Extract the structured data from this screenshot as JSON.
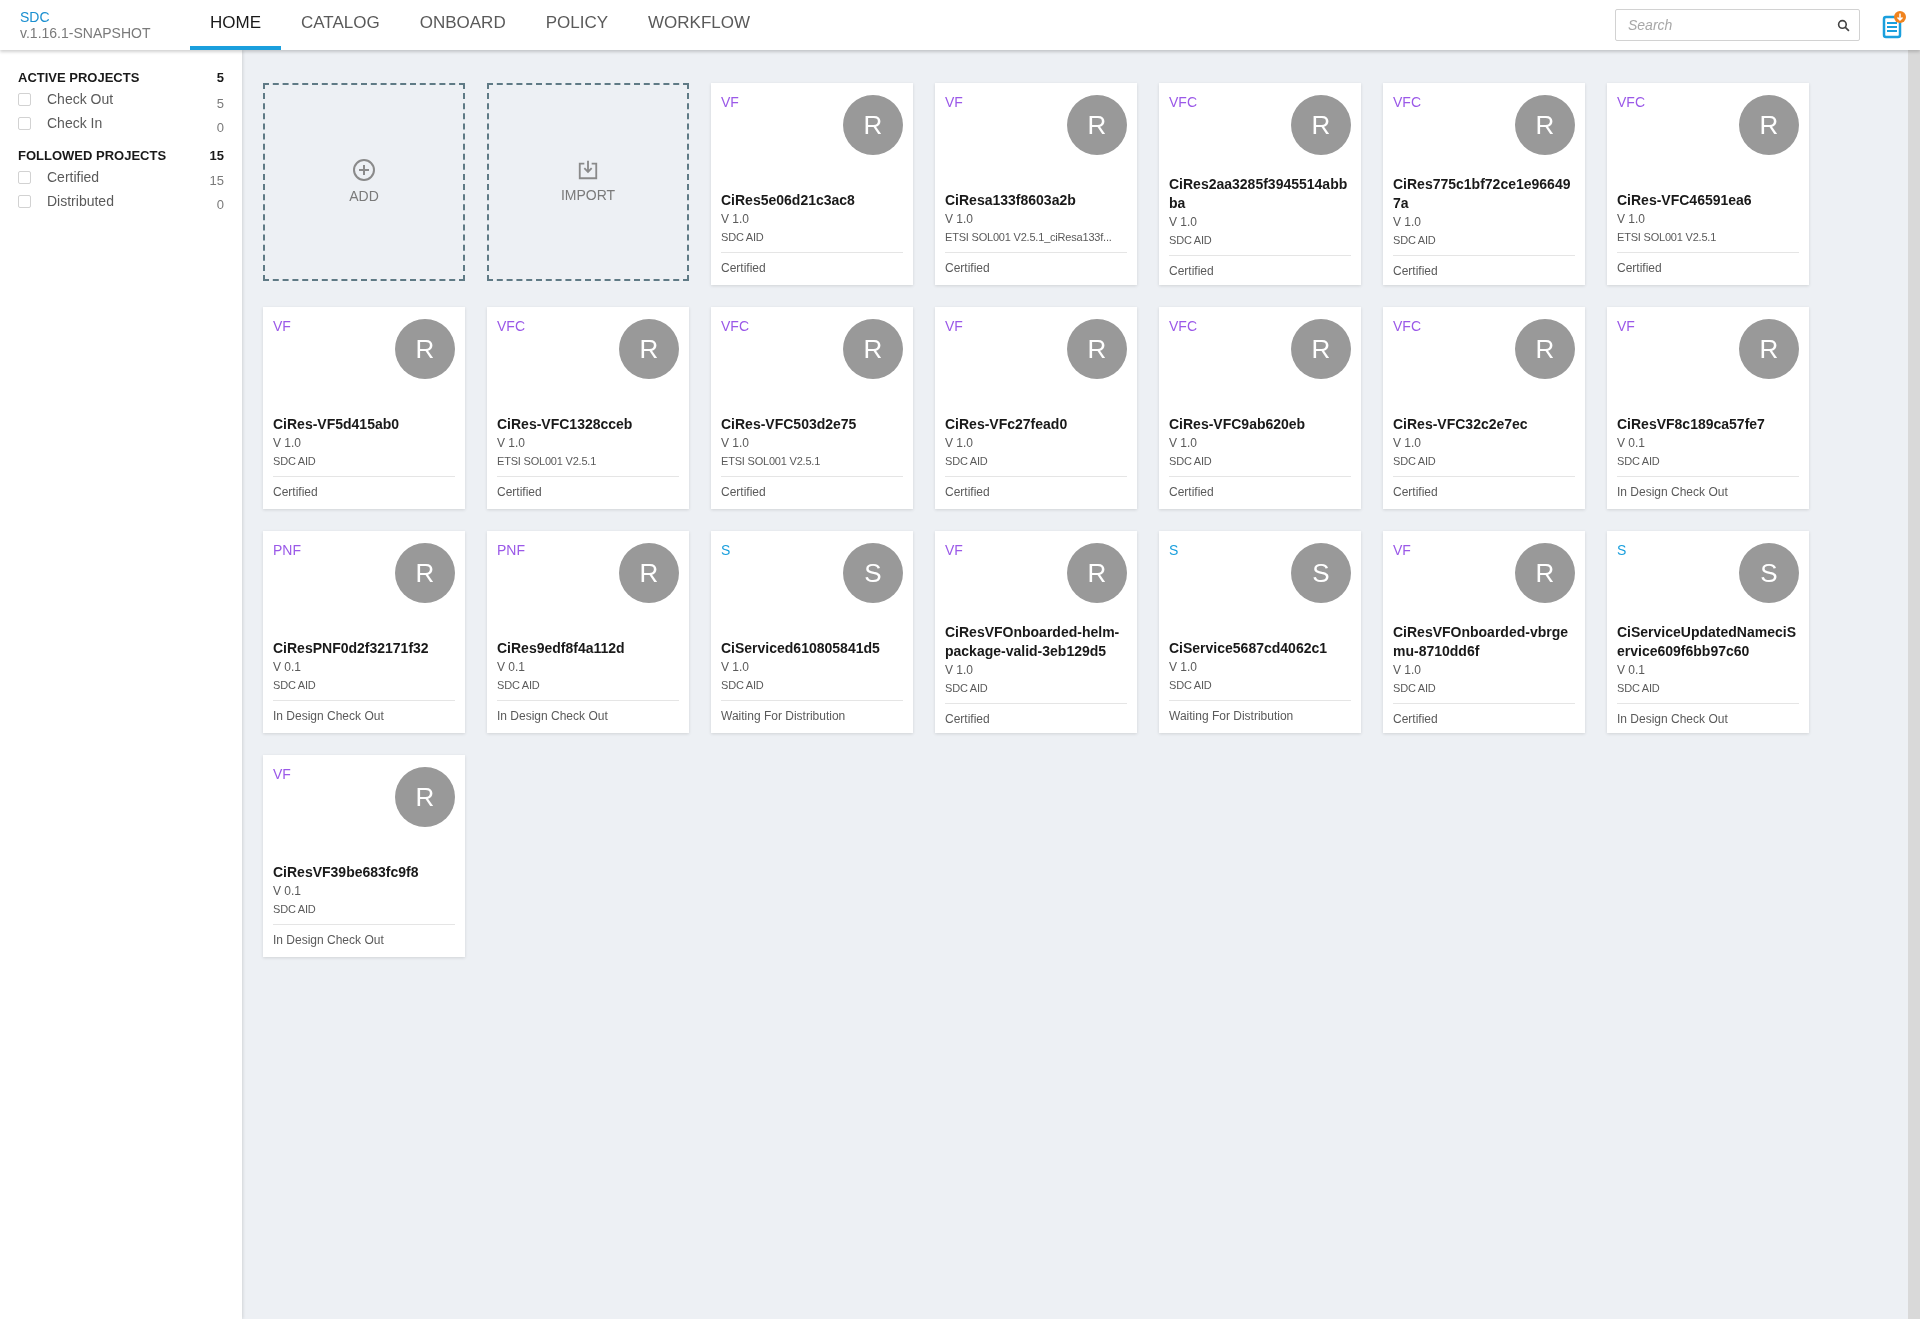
{
  "app": {
    "name": "SDC",
    "version": "v.1.16.1-SNAPSHOT"
  },
  "tabs": [
    {
      "label": "HOME",
      "selected": true
    },
    {
      "label": "CATALOG",
      "selected": false
    },
    {
      "label": "ONBOARD",
      "selected": false
    },
    {
      "label": "POLICY",
      "selected": false
    },
    {
      "label": "WORKFLOW",
      "selected": false
    }
  ],
  "search": {
    "placeholder": "Search"
  },
  "sidebar": {
    "sections": [
      {
        "title": "ACTIVE PROJECTS",
        "count": "5",
        "items": [
          {
            "label": "Check Out",
            "count": "5",
            "checked": false
          },
          {
            "label": "Check In",
            "count": "0",
            "checked": false
          }
        ]
      },
      {
        "title": "FOLLOWED PROJECTS",
        "count": "15",
        "items": [
          {
            "label": "Certified",
            "count": "15",
            "checked": false
          },
          {
            "label": "Distributed",
            "count": "0",
            "checked": false
          }
        ]
      }
    ]
  },
  "actions": [
    {
      "kind": "add",
      "label": "ADD"
    },
    {
      "kind": "import",
      "label": "IMPORT"
    }
  ],
  "cards": [
    {
      "type": "VF",
      "color": "#9b59e8",
      "avatar": "R",
      "name": "CiRes5e06d21c3ac8",
      "version": "V 1.0",
      "vendor": "SDC AID",
      "status": "Certified"
    },
    {
      "type": "VF",
      "color": "#9b59e8",
      "avatar": "R",
      "name": "CiResa133f8603a2b",
      "version": "V 1.0",
      "vendor": "ETSI SOL001 V2.5.1_ciResa133f...",
      "status": "Certified"
    },
    {
      "type": "VFC",
      "color": "#9b59e8",
      "avatar": "R",
      "name": "CiRes2aa3285f3945514abbba",
      "version": "V 1.0",
      "vendor": "SDC AID",
      "status": "Certified"
    },
    {
      "type": "VFC",
      "color": "#9b59e8",
      "avatar": "R",
      "name": "CiRes775c1bf72ce1e966497a",
      "version": "V 1.0",
      "vendor": "SDC AID",
      "status": "Certified"
    },
    {
      "type": "VFC",
      "color": "#9b59e8",
      "avatar": "R",
      "name": "CiRes-VFC46591ea6",
      "version": "V 1.0",
      "vendor": "ETSI SOL001 V2.5.1",
      "status": "Certified"
    },
    {
      "type": "VF",
      "color": "#9b59e8",
      "avatar": "R",
      "name": "CiRes-VF5d415ab0",
      "version": "V 1.0",
      "vendor": "SDC AID",
      "status": "Certified"
    },
    {
      "type": "VFC",
      "color": "#9b59e8",
      "avatar": "R",
      "name": "CiRes-VFC1328cceb",
      "version": "V 1.0",
      "vendor": "ETSI SOL001 V2.5.1",
      "status": "Certified"
    },
    {
      "type": "VFC",
      "color": "#9b59e8",
      "avatar": "R",
      "name": "CiRes-VFC503d2e75",
      "version": "V 1.0",
      "vendor": "ETSI SOL001 V2.5.1",
      "status": "Certified"
    },
    {
      "type": "VF",
      "color": "#9b59e8",
      "avatar": "R",
      "name": "CiRes-VFc27fead0",
      "version": "V 1.0",
      "vendor": "SDC AID",
      "status": "Certified"
    },
    {
      "type": "VFC",
      "color": "#9b59e8",
      "avatar": "R",
      "name": "CiRes-VFC9ab620eb",
      "version": "V 1.0",
      "vendor": "SDC AID",
      "status": "Certified"
    },
    {
      "type": "VFC",
      "color": "#9b59e8",
      "avatar": "R",
      "name": "CiRes-VFC32c2e7ec",
      "version": "V 1.0",
      "vendor": "SDC AID",
      "status": "Certified"
    },
    {
      "type": "VF",
      "color": "#9b59e8",
      "avatar": "R",
      "name": "CiResVF8c189ca57fe7",
      "version": "V 0.1",
      "vendor": "SDC AID",
      "status": "In Design Check Out"
    },
    {
      "type": "PNF",
      "color": "#9b59e8",
      "avatar": "R",
      "name": "CiResPNF0d2f32171f32",
      "version": "V 0.1",
      "vendor": "SDC AID",
      "status": "In Design Check Out"
    },
    {
      "type": "PNF",
      "color": "#9b59e8",
      "avatar": "R",
      "name": "CiRes9edf8f4a112d",
      "version": "V 0.1",
      "vendor": "SDC AID",
      "status": "In Design Check Out"
    },
    {
      "type": "S",
      "color": "#1a9fdd",
      "avatar": "S",
      "name": "CiServiced610805841d5",
      "version": "V 1.0",
      "vendor": "SDC AID",
      "status": "Waiting For Distribution"
    },
    {
      "type": "VF",
      "color": "#9b59e8",
      "avatar": "R",
      "name": "CiResVFOnboarded-helm-package-valid-3eb129d5",
      "version": "V 1.0",
      "vendor": "SDC AID",
      "status": "Certified"
    },
    {
      "type": "S",
      "color": "#1a9fdd",
      "avatar": "S",
      "name": "CiService5687cd4062c1",
      "version": "V 1.0",
      "vendor": "SDC AID",
      "status": "Waiting For Distribution"
    },
    {
      "type": "VF",
      "color": "#9b59e8",
      "avatar": "R",
      "name": "CiResVFOnboarded-vbrgemu-8710dd6f",
      "version": "V 1.0",
      "vendor": "SDC AID",
      "status": "Certified"
    },
    {
      "type": "S",
      "color": "#1a9fdd",
      "avatar": "S",
      "name": "CiServiceUpdatedNameciService609f6bb97c60",
      "version": "V 0.1",
      "vendor": "SDC AID",
      "status": "In Design Check Out"
    },
    {
      "type": "VF",
      "color": "#9b59e8",
      "avatar": "R",
      "name": "CiResVF39be683fc9f8",
      "version": "V 0.1",
      "vendor": "SDC AID",
      "status": "In Design Check Out"
    }
  ]
}
